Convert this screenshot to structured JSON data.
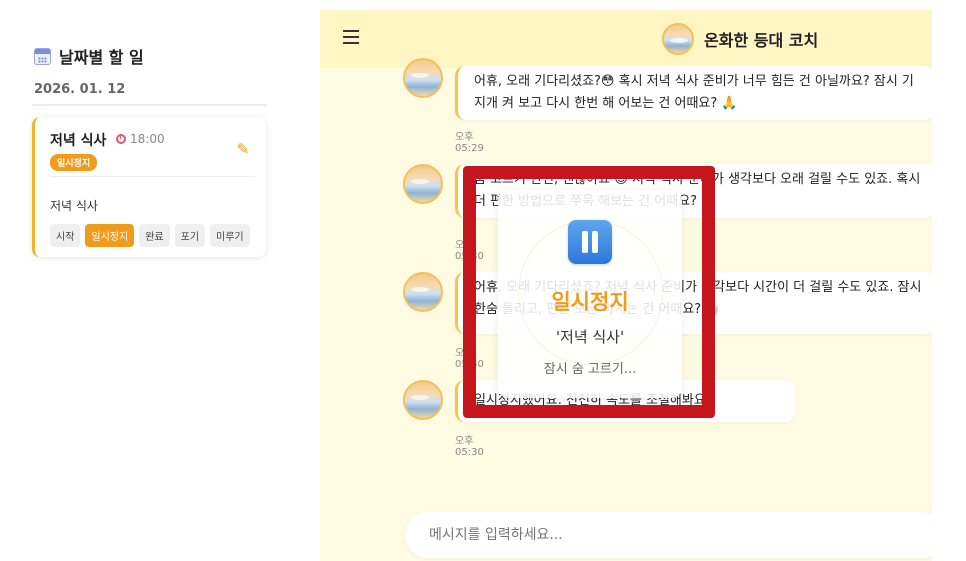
{
  "sidebar": {
    "title": "날짜별 할 일",
    "date": "2026. 01. 12",
    "task": {
      "name": "저녁 식사",
      "alarm_time": "18:00",
      "status": "일시정지",
      "description": "저녁 식사",
      "actions": [
        "시작",
        "일시정지",
        "완료",
        "포기",
        "미루기"
      ],
      "active_action": "일시정지"
    }
  },
  "chat": {
    "header_title": "온화한 등대 코치",
    "messages": [
      {
        "text": "어휴, 오래 기다리셨죠?😳 혹시 저녁 식사 준비가 너무 힘든 건 아닐까요? 잠시 기지개 켜 보고 다시 한번 해 어보는 건 어때요? 🙏",
        "time": "오후 05:29"
      },
      {
        "text": "숨 고르기 한번, 괜찮아요 😊 저녁 식사 준비가 생각보다 오래 걸릴 수도 있죠. 혹시 더 편한 방법으로 쭈욱 해보는 건 어때요? 🙏",
        "time": "오후 05:30"
      },
      {
        "text": "어휴, 오래 기다리셨죠? 저녁 식사 준비가 생각보다 시간이 더 걸릴 수도 있죠. 잠시 한숨 돌리고, 편한 모금 마시는 건 어때요? 🍵",
        "time": "오후 05:30"
      },
      {
        "text": "일시정지했어요. 천천히 속도를 조절해봐요.",
        "time": "오후 05:30"
      }
    ],
    "input_placeholder": "메시지를 입력하세요..."
  },
  "pause_overlay": {
    "title": "일시정지",
    "task": "'저녁 식사'",
    "subtitle": "잠시 숨 고르기..."
  },
  "colors": {
    "accent": "#f29b1a",
    "chat_bg": "#fffbe3",
    "header_bg": "#fff6c4",
    "highlight": "#c4161c"
  }
}
